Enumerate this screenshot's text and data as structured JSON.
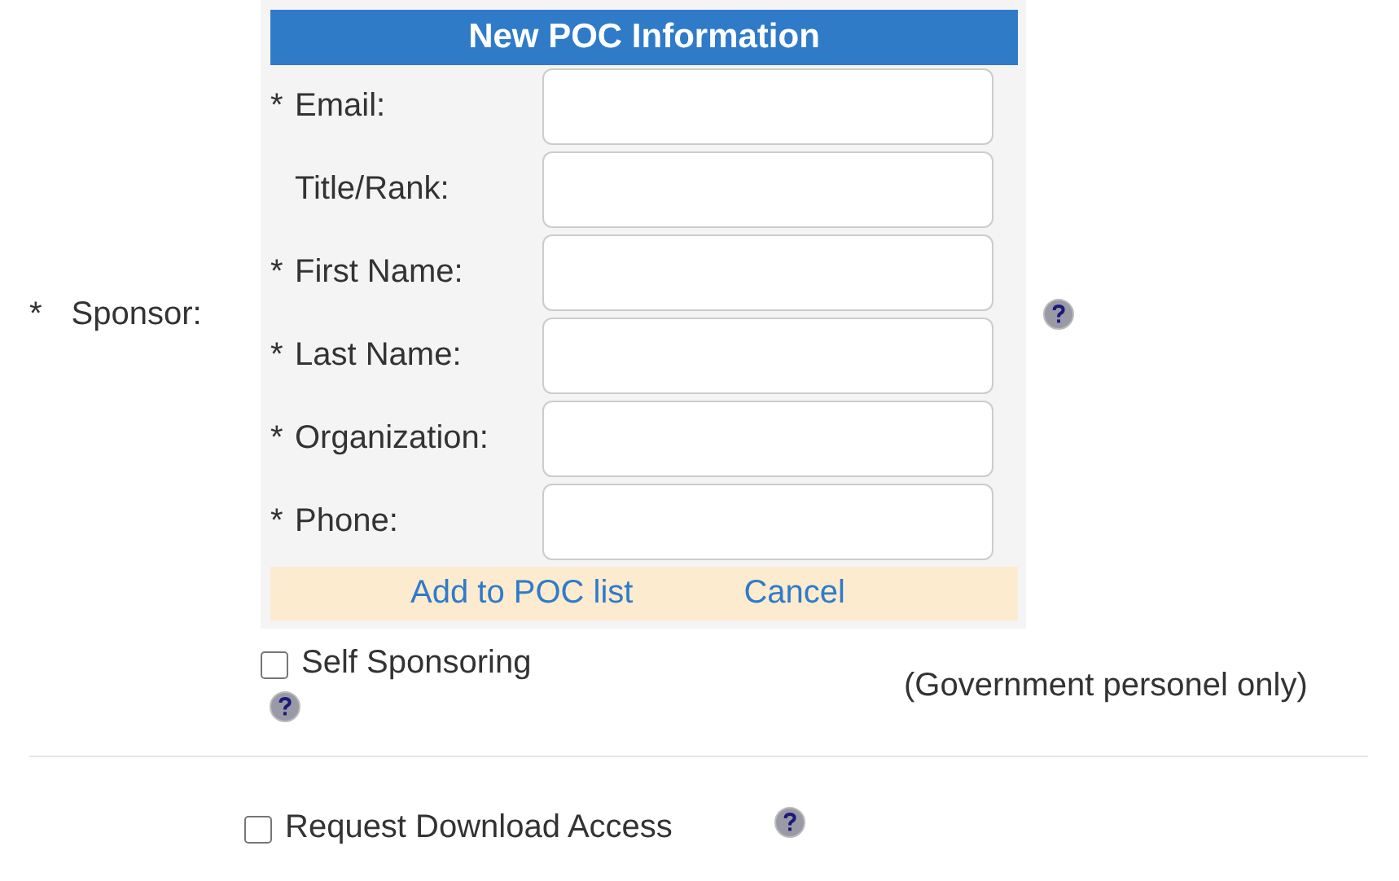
{
  "sponsor": {
    "required_mark": "*",
    "label": "Sponsor:"
  },
  "poc_panel": {
    "title": "New POC Information",
    "required_mark": "*",
    "fields": [
      {
        "required": true,
        "label": "Email:"
      },
      {
        "required": false,
        "label": "Title/Rank:"
      },
      {
        "required": true,
        "label": "First Name:"
      },
      {
        "required": true,
        "label": "Last Name:"
      },
      {
        "required": true,
        "label": "Organization:"
      },
      {
        "required": true,
        "label": "Phone:"
      }
    ],
    "links": [
      "Add to POC list",
      "Cancel"
    ]
  },
  "self_sponsoring": {
    "label": "Self Sponsoring",
    "checked": false,
    "note": "(Government personel only)"
  },
  "download_access": {
    "label": "Request Download Access",
    "checked": false
  }
}
